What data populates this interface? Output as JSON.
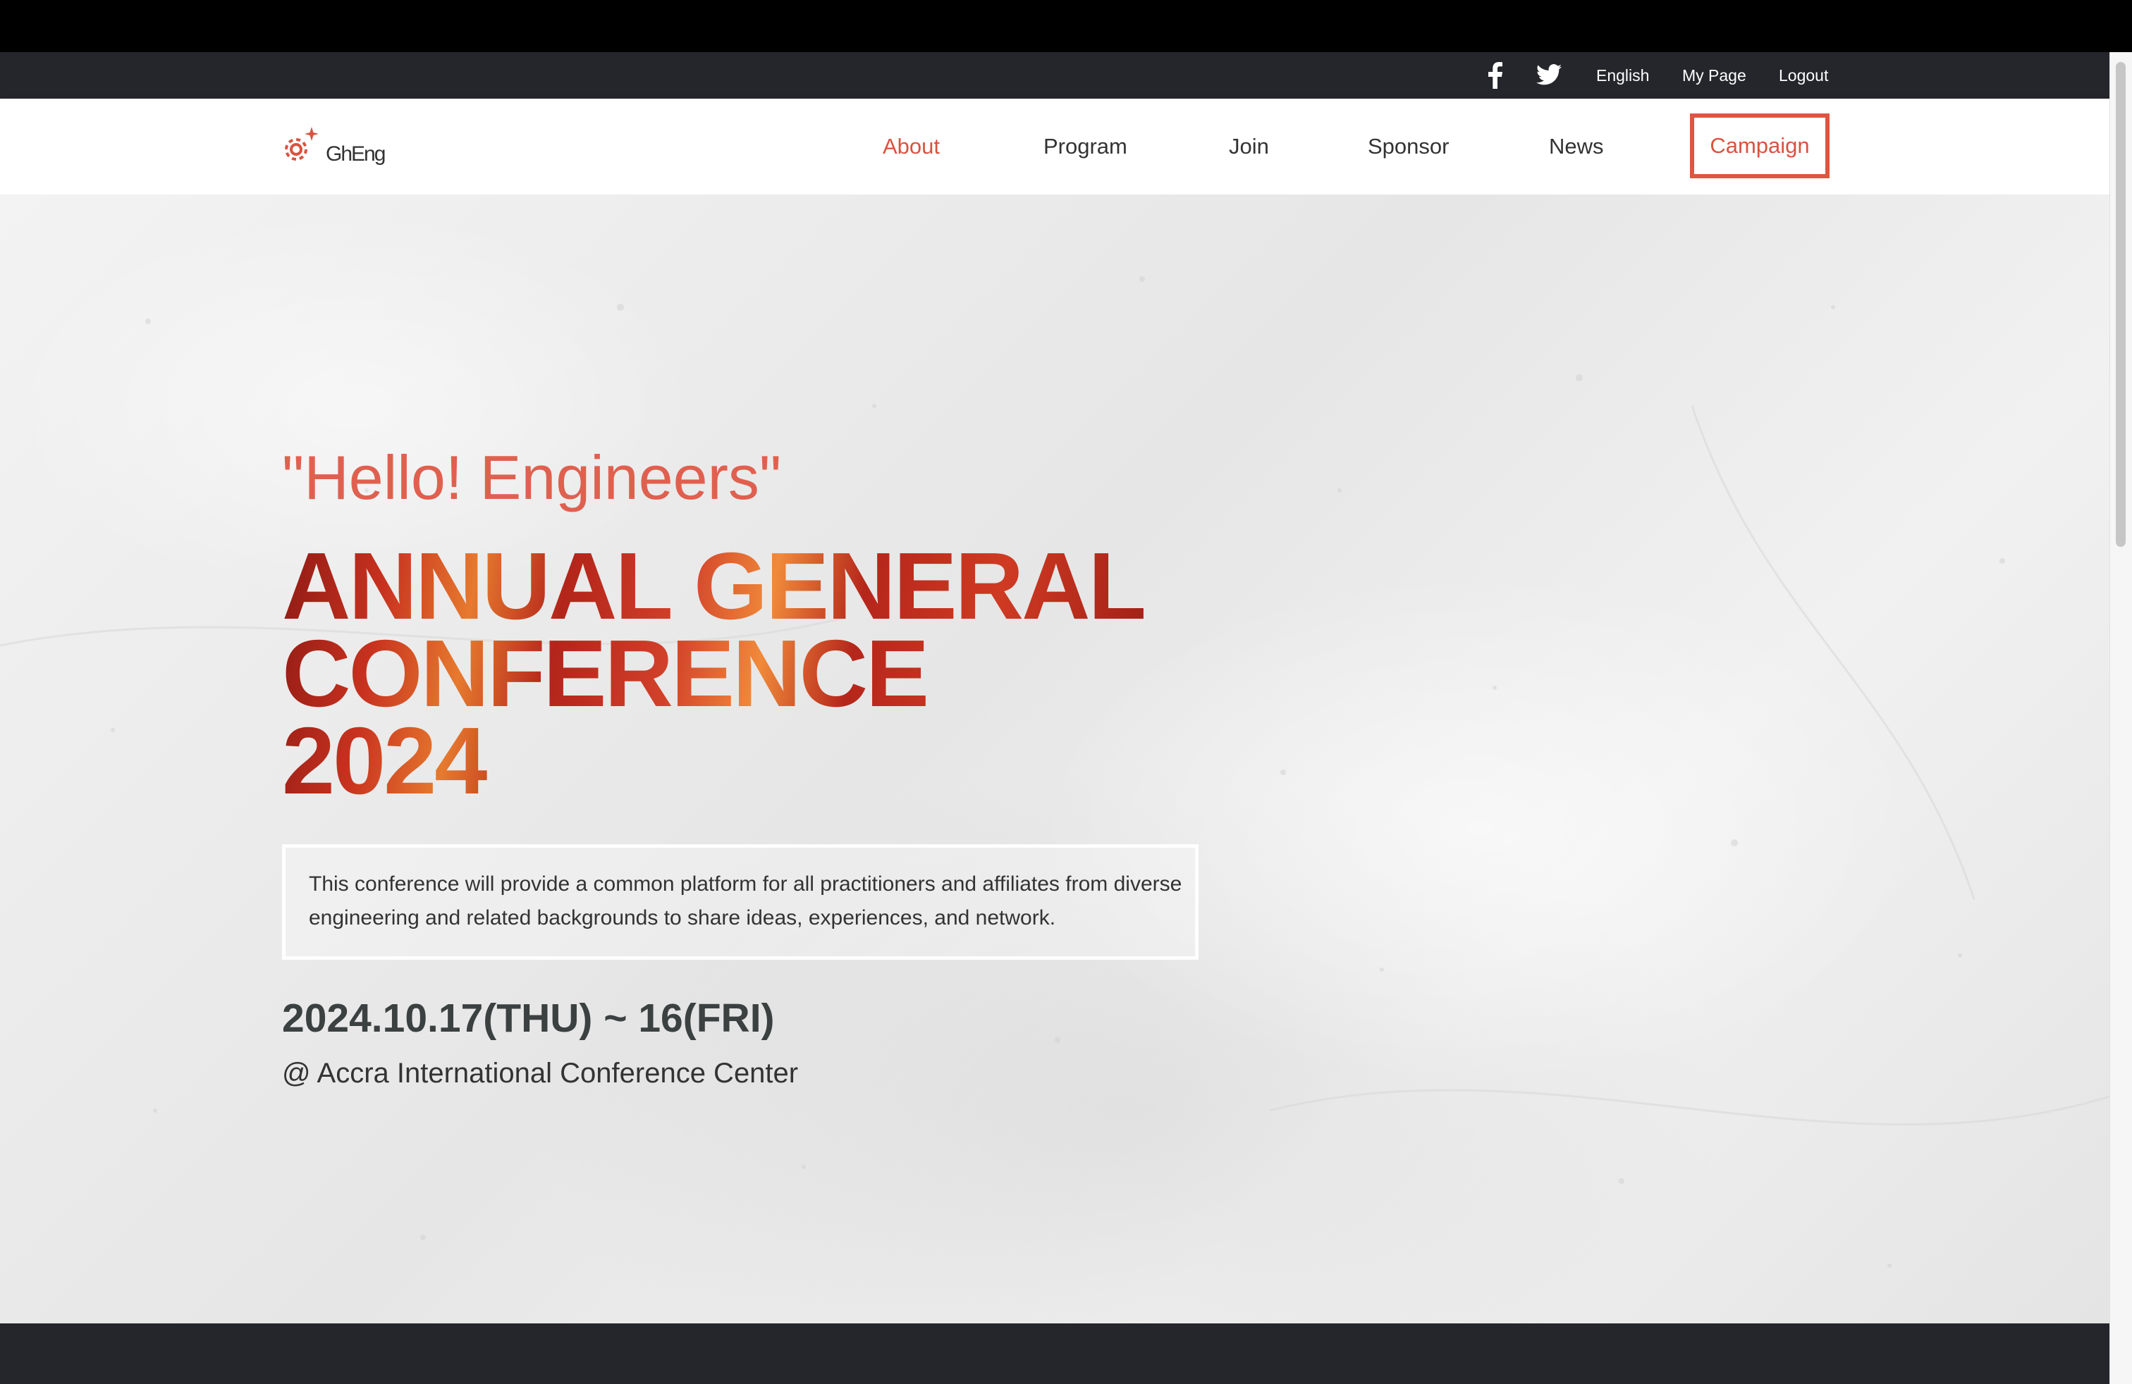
{
  "utility_bar": {
    "social": [
      "facebook-icon",
      "twitter-icon"
    ],
    "language": "English",
    "my_page": "My Page",
    "logout": "Logout"
  },
  "nav": {
    "logo_text": "GhEng",
    "items": [
      {
        "label": "About",
        "active": true
      },
      {
        "label": "Program"
      },
      {
        "label": "Join"
      },
      {
        "label": "Sponsor"
      },
      {
        "label": "News"
      }
    ],
    "campaign": "Campaign"
  },
  "hero": {
    "tagline": "\"Hello! Engineers\"",
    "headline": [
      "ANNUAL GENERAL",
      "CONFERENCE",
      "2024"
    ],
    "description": "This conference will provide a common platform for all practitioners and affiliates from diverse engineering and related backgrounds to share ideas, experiences, and network.",
    "date": "2024.10.17(THU) ~ 16(FRI)",
    "venue": "@ Accra International Conference Center"
  },
  "colors": {
    "accent": "#d9533f",
    "dark_bar": "#25262b",
    "headline_red": "#c8321f"
  }
}
